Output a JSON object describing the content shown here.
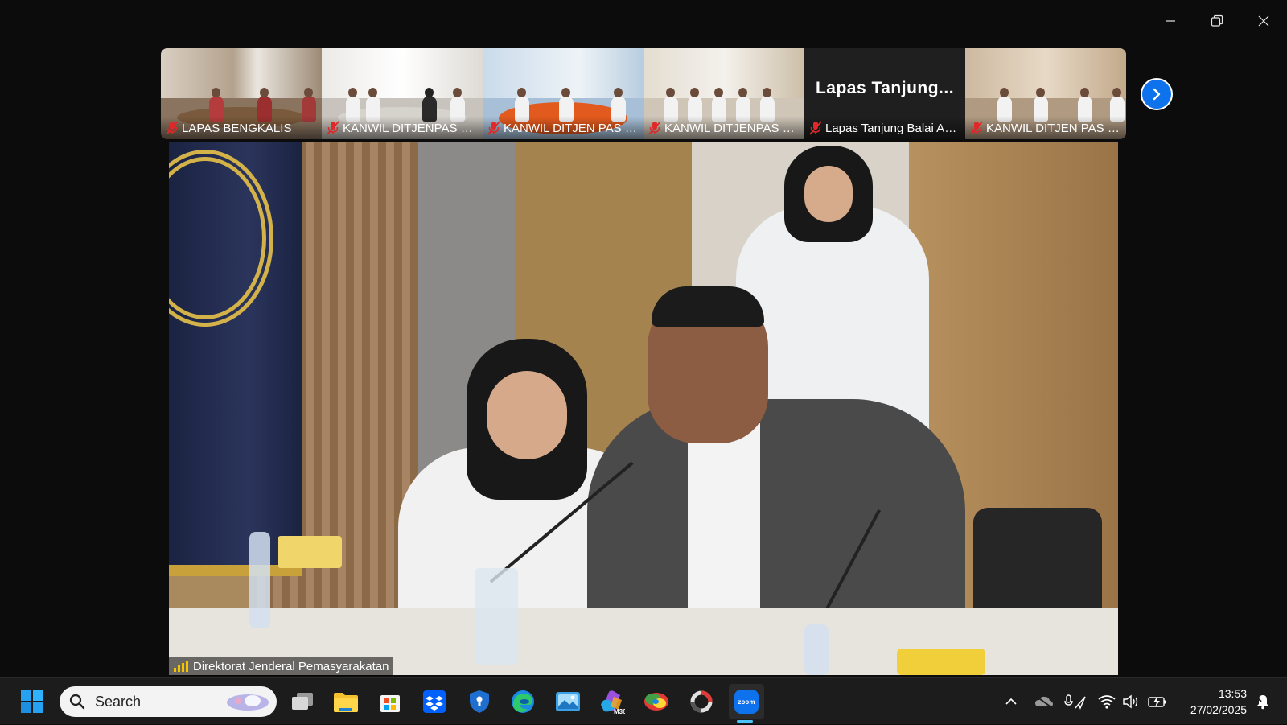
{
  "window": {
    "controls": [
      "minimize",
      "restore",
      "close"
    ]
  },
  "thumbnails": [
    {
      "name": "LAPAS BENGKALIS",
      "muted": true
    },
    {
      "name": "KANWIL DITJENPAS S...",
      "muted": true
    },
    {
      "name": "KANWIL DITJEN PAS P...",
      "muted": true
    },
    {
      "name": "KANWIL DITJENPAS S...",
      "muted": true
    },
    {
      "name": "Lapas Tanjung Balai As...",
      "big_label": "Lapas  Tanjung...",
      "muted": true,
      "video_off": true
    },
    {
      "name": "KANWIL DITJEN PAS B...",
      "muted": true
    }
  ],
  "main_video": {
    "participant_name": "Direktorat Jenderal Pemasyarakatan"
  },
  "taskbar": {
    "search_placeholder": "Search",
    "apps": [
      "windows-start",
      "task-view",
      "file-explorer",
      "microsoft-store",
      "dropbox",
      "bitwarden",
      "edge",
      "photos",
      "microsoft-365",
      "chrome-like",
      "app-ring",
      "zoom"
    ],
    "zoom_label": "zoom",
    "m365_label": "M365",
    "time": "13:53",
    "date": "27/02/2025"
  },
  "colors": {
    "zoom_blue": "#0e72ed",
    "mute_red": "#e02828",
    "signal_yellow": "#f5c400"
  }
}
